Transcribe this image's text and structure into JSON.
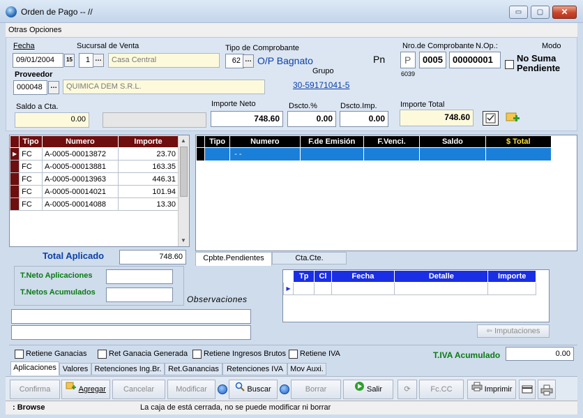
{
  "window": {
    "title": "Orden de Pago -- //",
    "min": "▭",
    "max": "▢",
    "close": "✕"
  },
  "menu": {
    "item": "Otras Opciones"
  },
  "header": {
    "fecha_label": "Fecha",
    "fecha_value": "09/01/2004",
    "calendar_icon": "15",
    "sucursal_label": "Sucursal de Venta",
    "sucursal_code": "1",
    "sucursal_name": "Casa Central",
    "tipo_label": "Tipo de Comprobante",
    "tipo_code": "62",
    "tipo_name": "O/P Bagnato",
    "pn_label": "Pn",
    "nro_label": "Nro.de Comprobante",
    "nop_label": "N.Op.:",
    "modo_label": "Modo",
    "nro_letter": "P",
    "nro_pv": "0005",
    "nro_num": "00000001",
    "nro_small": "6039",
    "no_suma_label": "No Suma Pendiente",
    "proveedor_label": "Proveedor",
    "proveedor_code": "000048",
    "proveedor_name": "QUIMICA DEM S.R.L.",
    "grupo_label": "Grupo",
    "cuit": "30-59171041-5",
    "saldo_label": "Saldo a Cta.",
    "saldo_value": "0.00",
    "importe_neto_label": "Importe Neto",
    "importe_neto_value": "748.60",
    "dscto_pct_label": "Dscto.%",
    "dscto_pct_value": "0.00",
    "dscto_imp_label": "Dscto.Imp.",
    "dscto_imp_value": "0.00",
    "importe_total_label": "Importe Total",
    "importe_total_value": "748.60",
    "dots": "…"
  },
  "left_grid": {
    "headers": [
      "Tipo",
      "Numero",
      "Importe"
    ],
    "rows": [
      {
        "tipo": "FC",
        "numero": "A-0005-00013872",
        "importe": "23.70"
      },
      {
        "tipo": "FC",
        "numero": "A-0005-00013881",
        "importe": "163.35"
      },
      {
        "tipo": "FC",
        "numero": "A-0005-00013963",
        "importe": "446.31"
      },
      {
        "tipo": "FC",
        "numero": "A-0005-00014021",
        "importe": "101.94"
      },
      {
        "tipo": "FC",
        "numero": "A-0005-00014088",
        "importe": "13.30"
      }
    ]
  },
  "right_grid": {
    "headers": [
      "Tipo",
      "Numero",
      "F.de Emisión",
      "F.Venci.",
      "Saldo",
      "$ Total"
    ],
    "row": {
      "tipo": "",
      "numero": "-  -",
      "emision": "",
      "venci": "",
      "saldo": "",
      "total": ""
    }
  },
  "total_aplicado_label": "Total Aplicado",
  "total_aplicado_value": "748.60",
  "tabs_right": [
    "Cpbte.Pendientes",
    "Cta.Cte."
  ],
  "tneto_aplic_label": "T.Neto Aplicaciones",
  "tnetos_acum_label": "T.Netos Acumulados",
  "observaciones_label": "Observaciones",
  "small_grid": {
    "headers": [
      "Tp",
      "Cl",
      "Fecha",
      "Detalle",
      "Importe"
    ]
  },
  "imputaciones_label": "Imputaciones",
  "checkboxes": [
    "Retiene Ganacias",
    "Ret Ganacia Generada",
    "Retiene Ingresos Brutos",
    "Retiene IVA"
  ],
  "tiva_label": "T.IVA Acumulado",
  "tiva_value": "0.00",
  "tabs_bottom": [
    "Aplicaciones",
    "Valores",
    "Retenciones Ing.Br.",
    "Ret.Ganancias",
    "Retenciones IVA",
    "Mov Auxi."
  ],
  "toolbar": {
    "confirma": "Confirma",
    "agregar": "Agregar",
    "cancelar": "Cancelar",
    "modificar": "Modificar",
    "buscar": "Buscar",
    "borrar": "Borrar",
    "salir": "Salir",
    "fccc": "Fc.CC",
    "imprimir": "Imprimir"
  },
  "status": {
    "mode": ": Browse",
    "message": "La caja de está cerrada, no se puede modificar ni borrar"
  }
}
